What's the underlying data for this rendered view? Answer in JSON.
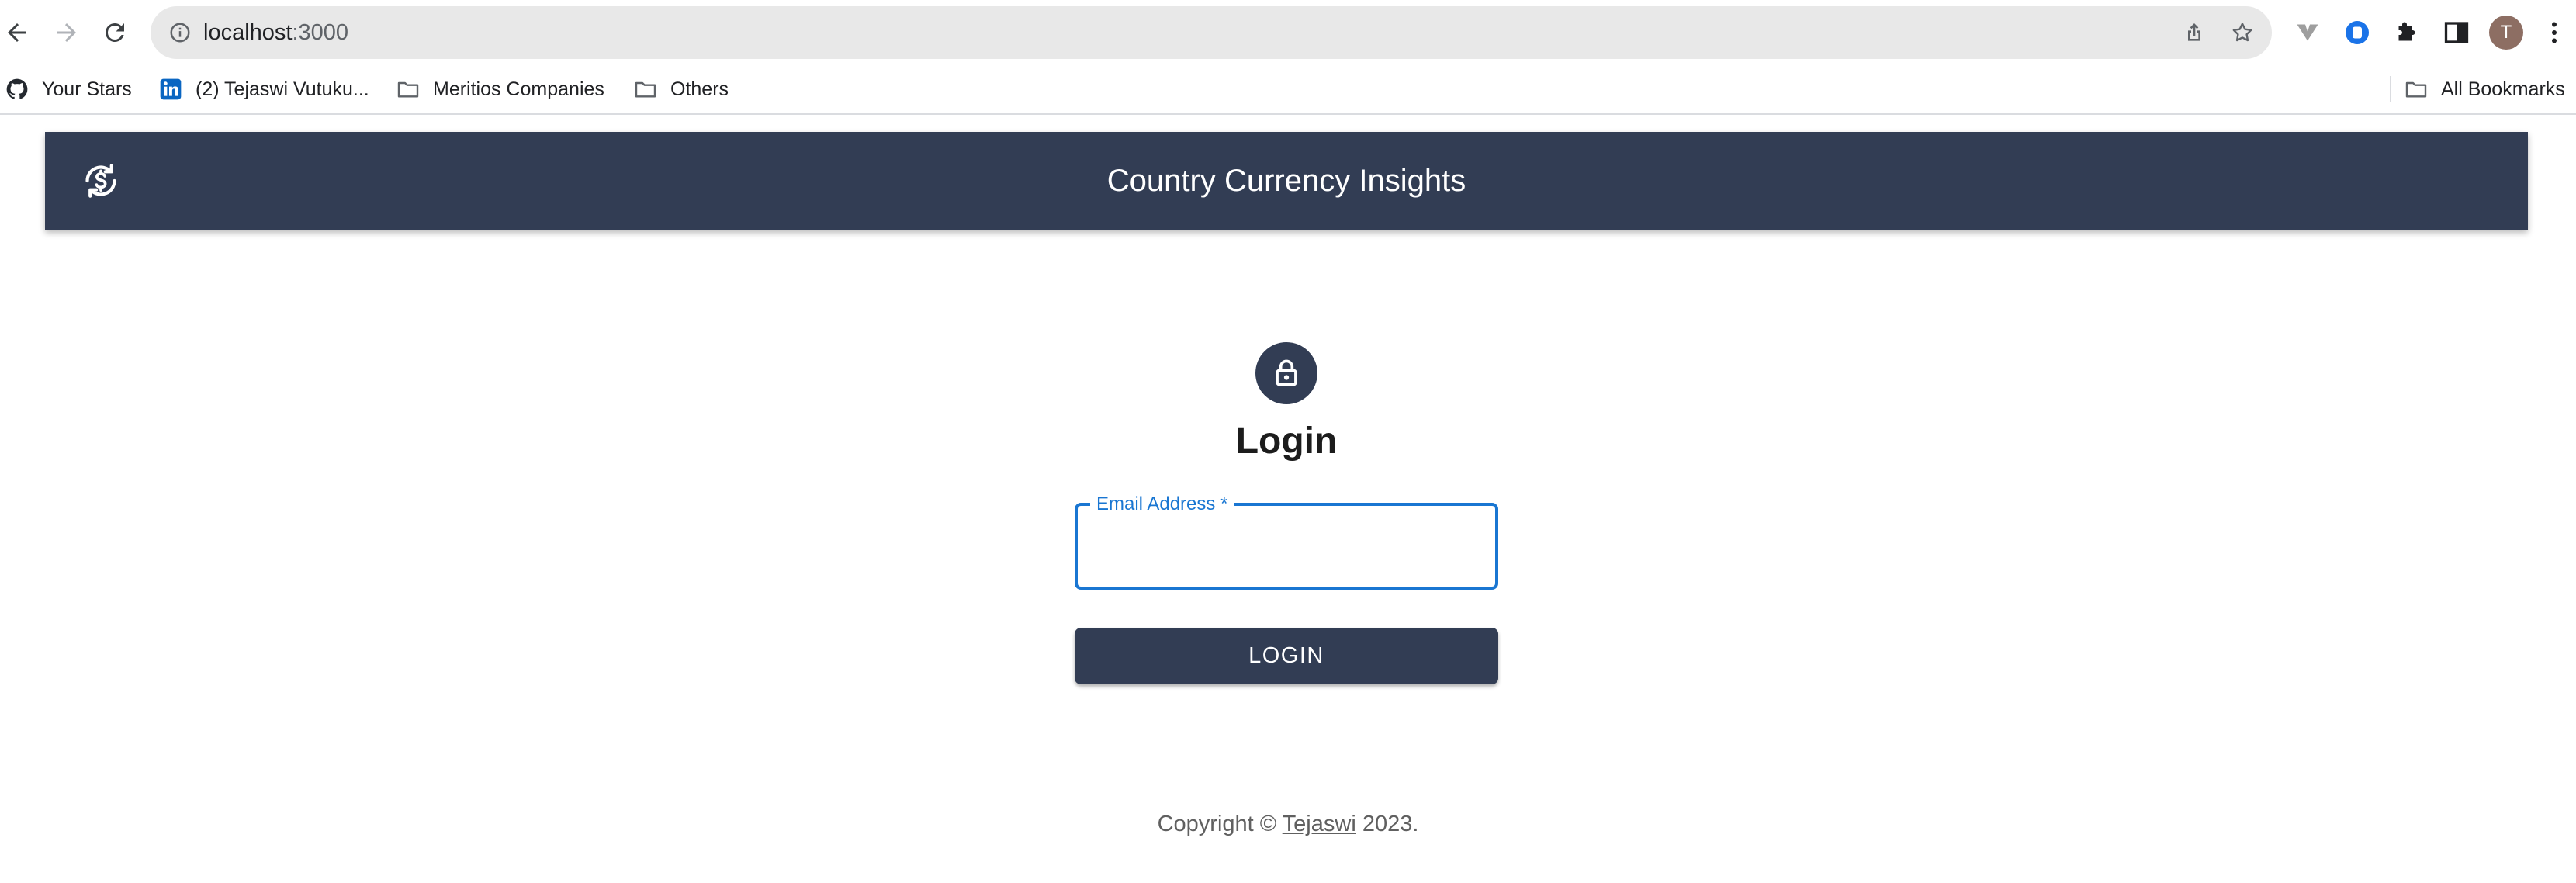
{
  "browser": {
    "url_host": "localhost",
    "url_port": ":3000",
    "profile_initial": "T",
    "bookmarks": [
      {
        "label": "Your Stars",
        "icon": "github-icon"
      },
      {
        "label": "(2) Tejaswi Vutuku...",
        "icon": "linkedin-icon"
      },
      {
        "label": "Meritios Companies",
        "icon": "folder-icon"
      },
      {
        "label": "Others",
        "icon": "folder-icon"
      }
    ],
    "all_bookmarks_label": "All Bookmarks"
  },
  "app": {
    "title": "Country Currency Insights",
    "logo_icon": "currency-exchange-icon",
    "brand_color": "#323d54"
  },
  "login": {
    "heading": "Login",
    "email_label": "Email Address *",
    "email_value": "",
    "submit_label": "LOGIN",
    "accent_color": "#1976d2"
  },
  "footer": {
    "prefix": "Copyright © ",
    "link_text": "Tejaswi",
    "suffix": " 2023."
  }
}
